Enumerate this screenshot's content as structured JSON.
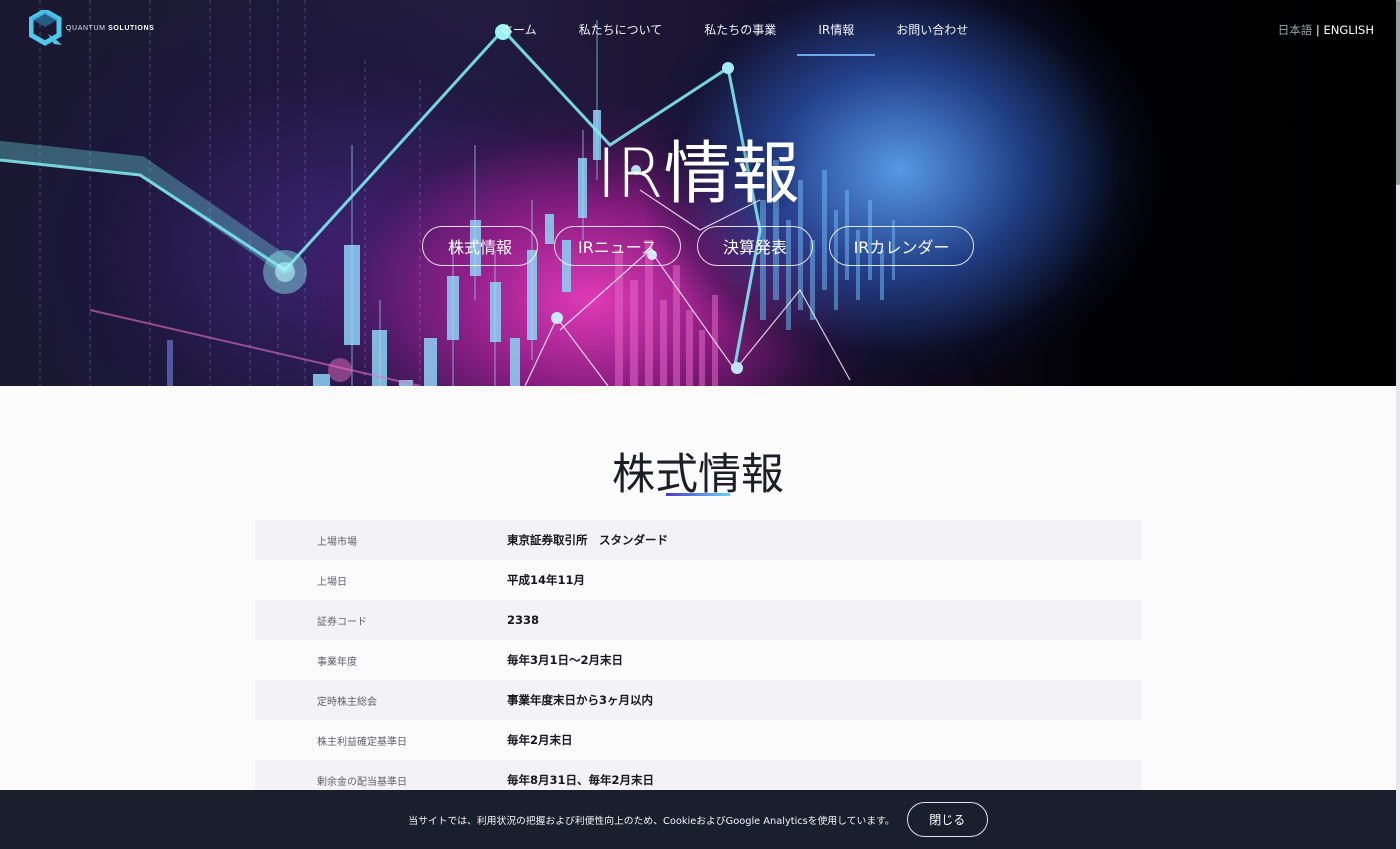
{
  "brand": {
    "name_light": "QUANTUM",
    "name_bold": "SOLUTIONS"
  },
  "nav": {
    "items": [
      {
        "label": "ホーム"
      },
      {
        "label": "私たちについて"
      },
      {
        "label": "私たちの事業"
      },
      {
        "label": "IR情報",
        "active": true
      },
      {
        "label": "お問い合わせ"
      }
    ]
  },
  "lang": {
    "ja": "日本語",
    "separator": " | ",
    "en": "ENGLISH"
  },
  "hero": {
    "title": "IR情報",
    "links": [
      {
        "label": "株式情報"
      },
      {
        "label": "IRニュース"
      },
      {
        "label": "決算発表"
      },
      {
        "label": "IRカレンダー"
      }
    ]
  },
  "section": {
    "title": "株式情報",
    "rows": [
      {
        "label": "上場市場",
        "value": "東京証券取引所　スタンダード"
      },
      {
        "label": "上場日",
        "value": "平成14年11月"
      },
      {
        "label": "証券コード",
        "value": "2338"
      },
      {
        "label": "事業年度",
        "value": "毎年3月1日～2月末日"
      },
      {
        "label": "定時株主総会",
        "value": "事業年度末日から3ヶ月以内"
      },
      {
        "label": "株主利益確定基準日",
        "value": "毎年2月末日"
      },
      {
        "label": "剰余金の配当基準日",
        "value": "毎年8月31日、毎年2月末日"
      }
    ]
  },
  "cookie": {
    "text": "当サイトでは、利用状況の把握および利便性向上のため、CookieおよびGoogle Analyticsを使用しています。",
    "close_label": "閉じる"
  },
  "colors": {
    "accent_underline_start": "#4b3ad0",
    "accent_underline_end": "#6ad0f2",
    "nav_active": "#6ea7ea",
    "cookie_bar": "#1a1f2e"
  }
}
